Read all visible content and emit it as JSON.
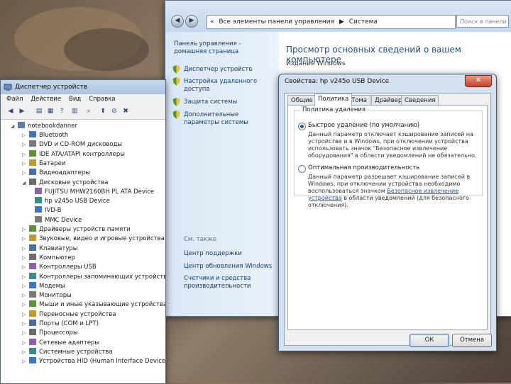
{
  "control_panel": {
    "breadcrumb": [
      "«",
      "Все элементы панели управления",
      "▶",
      "Система"
    ],
    "search_placeholder": "Поиск в панели",
    "left_links": [
      {
        "label": "Панель управления - домашняя страница",
        "shield": false
      },
      {
        "label": "Диспетчер устройств",
        "shield": true
      },
      {
        "label": "Настройка удаленного доступа",
        "shield": true
      },
      {
        "label": "Защита системы",
        "shield": true
      },
      {
        "label": "Дополнительные параметры системы",
        "shield": true
      }
    ],
    "see_also_title": "См. также",
    "see_also_links": [
      "Центр поддержки",
      "Центр обновления Windows",
      "Счетчики и средства производительности"
    ],
    "main_title": "Просмотр основных сведений о вашем компьютере",
    "edition_label": "Издание Windows"
  },
  "device_manager": {
    "title": "Диспетчер устройств",
    "menu": [
      "Файл",
      "Действие",
      "Вид",
      "Справка"
    ],
    "root": "notebookdanner",
    "tree": [
      {
        "label": "Bluetooth",
        "level": 1,
        "expanded": false
      },
      {
        "label": "DVD и CD-ROM дисководы",
        "level": 1,
        "expanded": false
      },
      {
        "label": "IDE ATA/ATAPI контроллеры",
        "level": 1,
        "expanded": false
      },
      {
        "label": "Батареи",
        "level": 1,
        "expanded": false
      },
      {
        "label": "Видеоадаптеры",
        "level": 1,
        "expanded": false
      },
      {
        "label": "Дисковые устройства",
        "level": 1,
        "expanded": true
      },
      {
        "label": "FUJITSU MHW2160BH PL ATA Device",
        "level": 2
      },
      {
        "label": "hp v245o USB Device",
        "level": 2
      },
      {
        "label": "IVD-B",
        "level": 2
      },
      {
        "label": "MMC Device",
        "level": 2
      },
      {
        "label": "Драйверы устройств памяти",
        "level": 1,
        "expanded": false
      },
      {
        "label": "Звуковые, видео и игровые устройства",
        "level": 1,
        "expanded": false
      },
      {
        "label": "Клавиатуры",
        "level": 1,
        "expanded": false
      },
      {
        "label": "Компьютер",
        "level": 1,
        "expanded": false
      },
      {
        "label": "Контроллеры USB",
        "level": 1,
        "expanded": false
      },
      {
        "label": "Контроллеры запоминающих устройств",
        "level": 1,
        "expanded": false
      },
      {
        "label": "Модемы",
        "level": 1,
        "expanded": false
      },
      {
        "label": "Мониторы",
        "level": 1,
        "expanded": false
      },
      {
        "label": "Мыши и иные указывающие устройства",
        "level": 1,
        "expanded": false
      },
      {
        "label": "Переносные устройства",
        "level": 1,
        "expanded": false
      },
      {
        "label": "Порты (COM и LPT)",
        "level": 1,
        "expanded": false
      },
      {
        "label": "Процессоры",
        "level": 1,
        "expanded": false
      },
      {
        "label": "Сетевые адаптеры",
        "level": 1,
        "expanded": false
      },
      {
        "label": "Системные устройства",
        "level": 1,
        "expanded": false
      },
      {
        "label": "Устройства HID (Human Interface Devices)",
        "level": 1,
        "expanded": false
      }
    ]
  },
  "properties": {
    "title": "Свойства: hp v245o USB Device",
    "close_glyph": "✕",
    "tabs": [
      "Общие",
      "Политика",
      "Тома",
      "Драйвер",
      "Сведения"
    ],
    "selected_tab": "Политика",
    "group_label": "Политика удаления",
    "option1_label": "Быстрое удаление (по умолчанию)",
    "option1_desc": "Данный параметр отключает кэширование записей на устройстве и в Windows, при отключении устройства использовать значок \"Безопасное извлечение оборудования\" в области уведомлений не обязательно.",
    "option2_label": "Оптимальная производительность",
    "option2_desc_a": "Данный параметр разрешает кэширование записей в Windows, при отключении устройства необходимо воспользоваться значком",
    "option2_link": "Безопасное извлечение устройства",
    "option2_desc_b": "в области уведомлений (для безопасного отключения).",
    "ok_label": "ОК",
    "cancel_label": "Отмена",
    "colors": {
      "accent": "#1a56b5",
      "title_bg": "#d2e0ef"
    }
  }
}
